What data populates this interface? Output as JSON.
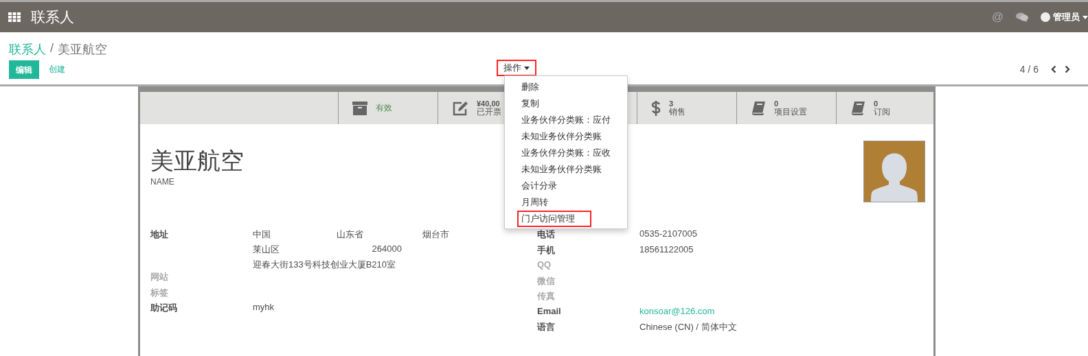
{
  "top_bar": {
    "app_title": "联系人",
    "mention_icon": "@",
    "user": {
      "name": "管理员"
    }
  },
  "breadcrumb": [
    {
      "label": "联系人",
      "link": true
    },
    {
      "separator": "/",
      "label": "美亚航空",
      "link": false
    }
  ],
  "buttons": [
    {
      "label": "编辑",
      "kind": "primary"
    },
    {
      "label": "创建",
      "kind": "link"
    }
  ],
  "actions": {
    "label": "操作",
    "highlighted": true,
    "expanded": true,
    "items": [
      {
        "label": "删除",
        "highlighted": false
      },
      {
        "label": "复制",
        "highlighted": false
      },
      {
        "label": "业务伙伴分类账：应付",
        "highlighted": false
      },
      {
        "label": "未知业务伙伴分类账",
        "highlighted": false
      },
      {
        "label": "业务伙伴分类账：应收",
        "highlighted": false
      },
      {
        "label": "未知业务伙伴分类账",
        "highlighted": false
      },
      {
        "label": "会计分录",
        "highlighted": false
      },
      {
        "label": "月周转",
        "highlighted": false
      },
      {
        "label": "门户访问管理",
        "highlighted": true
      }
    ]
  },
  "pager": "4 / 6",
  "stat_buttons": [
    {
      "kind": "archive",
      "label": "有效"
    },
    {
      "kind": "edit",
      "value": "¥40,00",
      "label": "已开票"
    },
    {
      "kind": "dollar",
      "value": "3",
      "label": "销售"
    },
    {
      "kind": "book",
      "value": "0",
      "label": "项目设置"
    },
    {
      "kind": "book",
      "value": "0",
      "label": "订阅"
    }
  ],
  "title": "美亚航空",
  "name_label": "NAME",
  "address": {
    "label": "地址",
    "country": "中国",
    "state": "山东省",
    "city": "烟台市",
    "district": "莱山区",
    "zip": "264000",
    "street": "迎春大街133号科技创业大厦B210室"
  },
  "left_fields": [
    {
      "label": "网站",
      "filled": false
    },
    {
      "label": "标签",
      "filled": false
    },
    {
      "label": "助记码",
      "filled": true,
      "value": "myhk"
    }
  ],
  "right_fields": [
    {
      "label": "电话",
      "filled": true,
      "value": "0535-2107005"
    },
    {
      "label": "手机",
      "filled": true,
      "value": "18561122005"
    },
    {
      "label": "QQ",
      "filled": false
    },
    {
      "label": "微信",
      "filled": false
    },
    {
      "label": "传真",
      "filled": false
    },
    {
      "label": "Email",
      "filled": true,
      "value": "konsoar@126.com",
      "kind": "link"
    },
    {
      "label": "语言",
      "filled": true,
      "value": "Chinese (CN) / 简体中文"
    }
  ]
}
